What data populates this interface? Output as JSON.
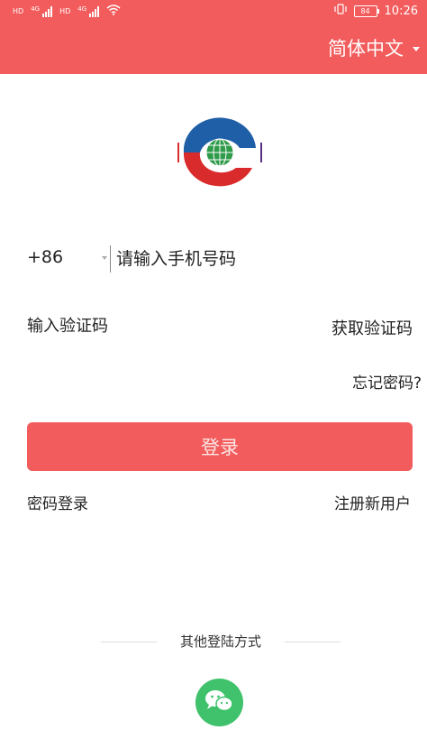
{
  "status_bar": {
    "sim1": "HD",
    "sim2": "HD",
    "signal_labels": [
      "4G",
      "4G"
    ],
    "battery": "84",
    "time": "10:26"
  },
  "header": {
    "language": "简体中文",
    "background_color": "#f25c5c"
  },
  "logo": {
    "icon": "globe-logo"
  },
  "form": {
    "country_code": "+86",
    "phone_placeholder": "请输入手机号码",
    "code_placeholder": "输入验证码",
    "get_code_label": "获取验证码",
    "forgot_password": "忘记密码?",
    "login_label": "登录",
    "password_login": "密码登录",
    "register": "注册新用户"
  },
  "other_login": {
    "title": "其他登陆方式",
    "wechat_icon": "wechat-icon",
    "wechat_color": "#3fc26b"
  }
}
